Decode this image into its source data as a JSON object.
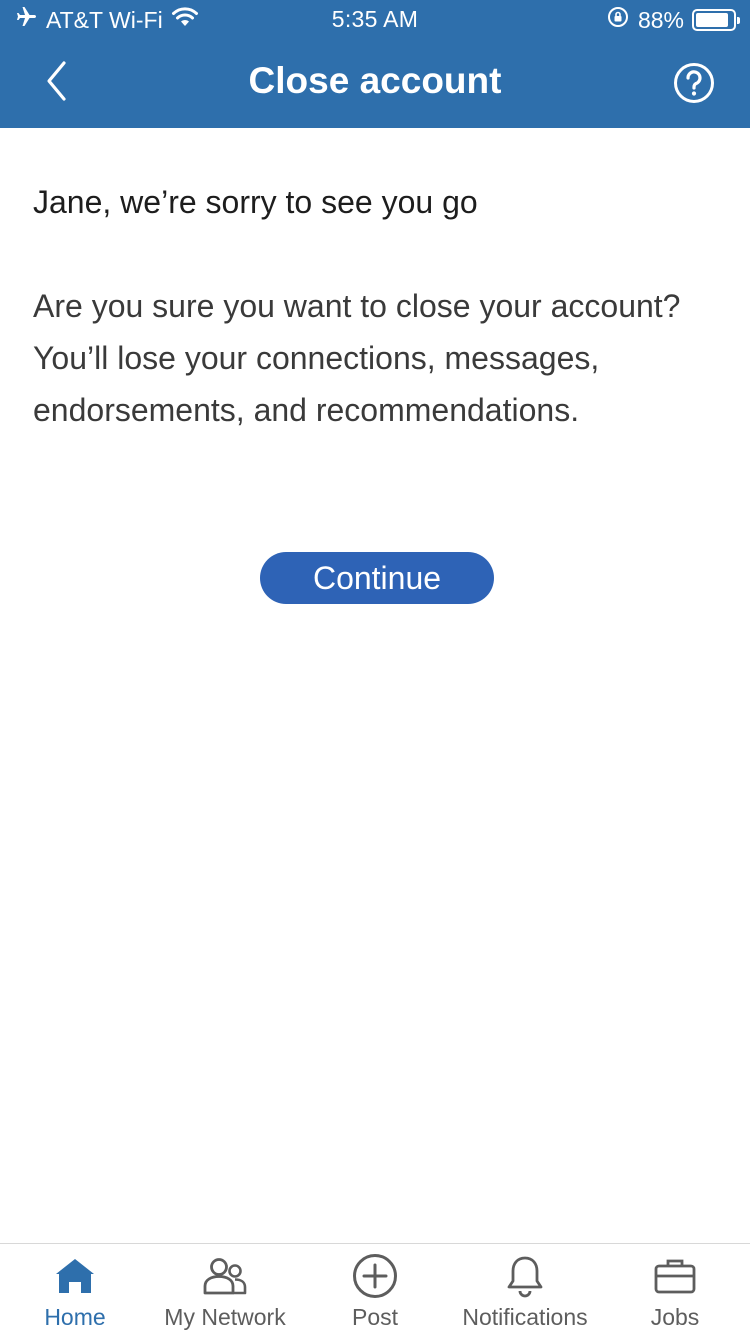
{
  "status_bar": {
    "carrier": "AT&T Wi-Fi",
    "time": "5:35 AM",
    "battery_percent": "88%",
    "battery_level": 0.88
  },
  "nav": {
    "title": "Close account",
    "back_icon": "chevron-left-icon",
    "help_icon": "help-circle-icon"
  },
  "content": {
    "headline": "Jane, we’re sorry to see you go",
    "body": "Are you sure you want to close your account? You’ll lose your connections, messages, endorsements, and recommendations.",
    "continue_label": "Continue"
  },
  "tabs": [
    {
      "label": "Home",
      "icon": "home-icon",
      "active": true
    },
    {
      "label": "My Network",
      "icon": "network-icon",
      "active": false
    },
    {
      "label": "Post",
      "icon": "plus-circle-icon",
      "active": false
    },
    {
      "label": "Notifications",
      "icon": "bell-icon",
      "active": false
    },
    {
      "label": "Jobs",
      "icon": "briefcase-icon",
      "active": false
    }
  ],
  "colors": {
    "header_blue": "#2e6fac",
    "button_blue": "#2e63b6",
    "active_tab": "#2e6fac",
    "inactive_tab": "#5d5d5d"
  }
}
